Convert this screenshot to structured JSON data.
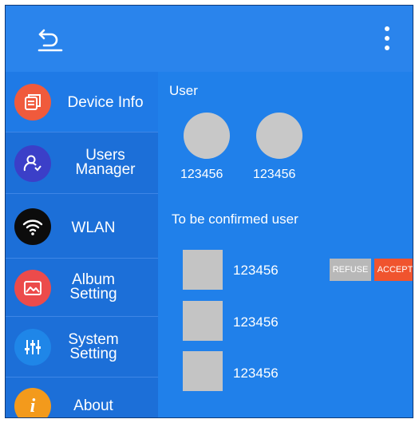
{
  "sidebar": {
    "items": [
      {
        "label": "Device Info",
        "icon": "device-info-icon",
        "color": "#f05a3c",
        "active": true
      },
      {
        "label": "Users Manager",
        "icon": "users-manager-icon",
        "color": "#3b3fc8"
      },
      {
        "label": "WLAN",
        "icon": "wifi-icon",
        "color": "#0c0c0c"
      },
      {
        "label": "Album Setting",
        "icon": "album-icon",
        "color": "#ec4b4b"
      },
      {
        "label": "System Setting",
        "icon": "sliders-icon",
        "color": "#1f86e8"
      },
      {
        "label": "About",
        "icon": "info-icon",
        "color": "#f39a1c"
      }
    ]
  },
  "users": {
    "title": "User",
    "list": [
      {
        "name": "123456"
      },
      {
        "name": "123456"
      }
    ]
  },
  "pending": {
    "title": "To be confirmed user",
    "list": [
      {
        "name": "123456",
        "refuse_label": "REFUSE",
        "accept_label": "ACCEPT"
      },
      {
        "name": "123456"
      },
      {
        "name": "123456"
      }
    ]
  },
  "colors": {
    "topbar": "#2a84ec",
    "sidebar": "#1c6fd8",
    "content": "#2080ea",
    "accept": "#f0542e",
    "refuse": "#b8b8b8"
  }
}
